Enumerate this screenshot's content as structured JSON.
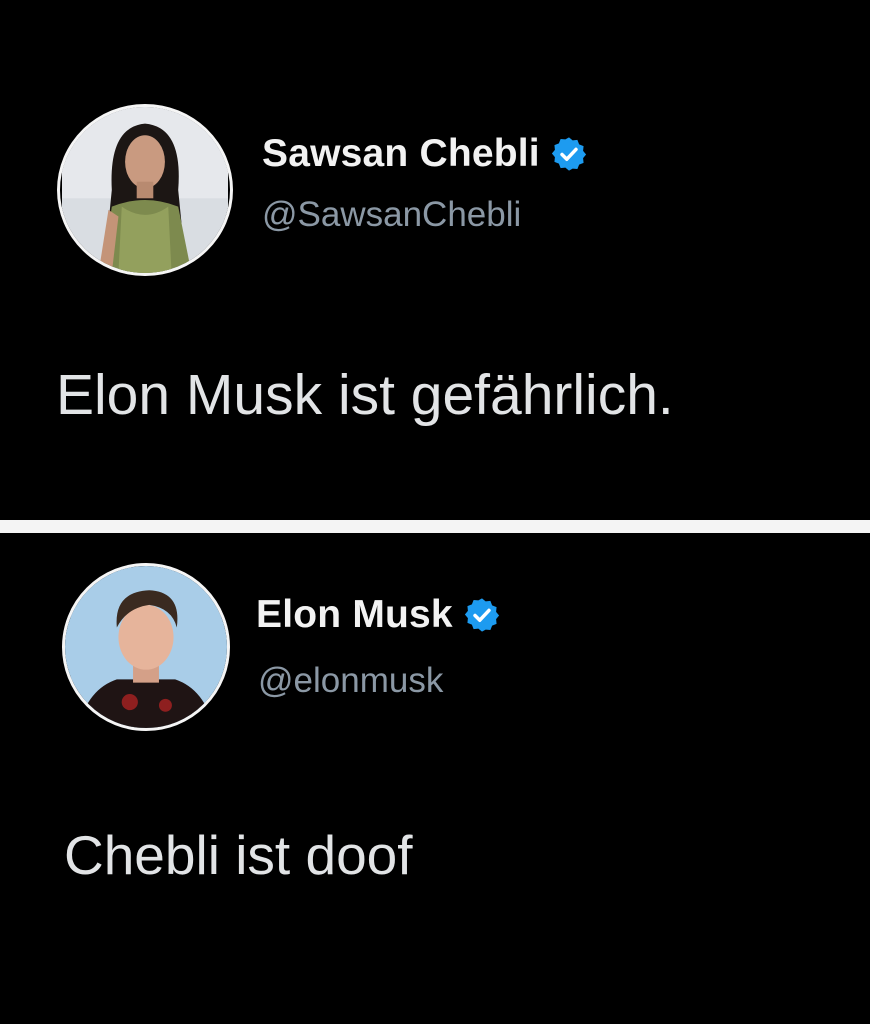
{
  "tweets": [
    {
      "display_name": "Sawsan Chebli",
      "handle": "@SawsanChebli",
      "text": "Elon Musk ist gefährlich.",
      "verified": true
    },
    {
      "display_name": "Elon Musk",
      "handle": "@elonmusk",
      "text": "Chebli ist doof",
      "verified": true
    }
  ],
  "colors": {
    "background": "#000000",
    "verified_badge": "#1d9bf0",
    "handle": "#8b98a5",
    "divider": "#f4f4f4"
  }
}
